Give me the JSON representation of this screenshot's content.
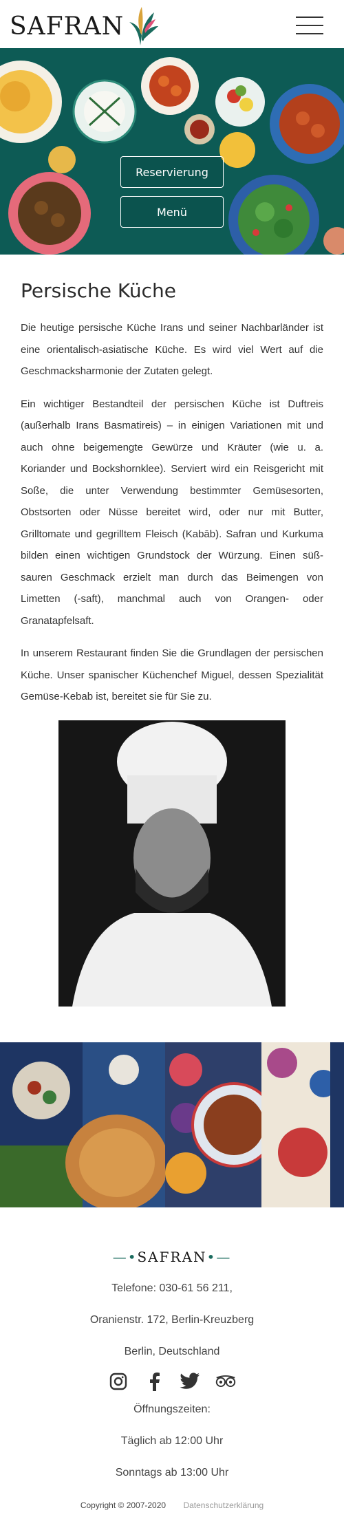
{
  "header": {
    "logo_text": "SAFRAN",
    "menu_icon": "hamburger-icon"
  },
  "hero": {
    "reservation_label": "Reservierung",
    "menu_label": "Menü"
  },
  "main": {
    "title": "Persische Küche",
    "paragraphs": [
      "Die heutige persische Küche Irans und seiner Nachbarländer ist eine orientalisch-asiatische Küche. Es wird viel Wert auf die Geschmacksharmonie der Zutaten gelegt.",
      "Ein wichtiger Bestandteil der persischen Küche ist Duftreis (außerhalb Irans Basmatireis) – in einigen Variationen mit und auch ohne beigemengte Gewürze und Kräuter (wie u. a. Koriander und Bockshornklee). Serviert wird ein Reisgericht mit Soße, die unter Verwendung bestimmter Gemüsesorten, Obstsorten oder Nüsse bereitet wird, oder nur mit Butter, Grilltomate und gegrilltem Fleisch (Kabāb). Safran und Kurkuma bilden einen wichtigen Grundstock der Würzung. Einen süß-sauren Geschmack erzielt man durch das Beimengen von Limetten (-saft), manchmal auch von Orangen- oder Granatapfelsaft.",
      "In unserem Restaurant finden Sie die Grundlagen der persischen Küche. Unser spanischer Küchenchef Miguel, dessen Spezialität Gemüse-Kebab ist, bereitet sie für Sie zu."
    ]
  },
  "footer": {
    "logo_text": "SAFRAN",
    "phone": "Telefone: 030-61 56 211,",
    "address": "Oranienstr. 172, Berlin-Kreuzberg",
    "city": "Berlin, Deutschland",
    "social_icons": [
      "instagram-icon",
      "facebook-icon",
      "twitter-icon",
      "tripadvisor-icon"
    ],
    "hours_title": "Öffnungszeiten:",
    "hours_weekday": "Täglich ab 12:00 Uhr",
    "hours_sunday": "Sonntags ab 13:00 Uhr",
    "copyright": "Copyright © 2007-2020",
    "privacy_link": "Datenschutzerklärung"
  },
  "colors": {
    "accent": "#1a6b5e",
    "hero_bg": "#0f5f5a"
  }
}
